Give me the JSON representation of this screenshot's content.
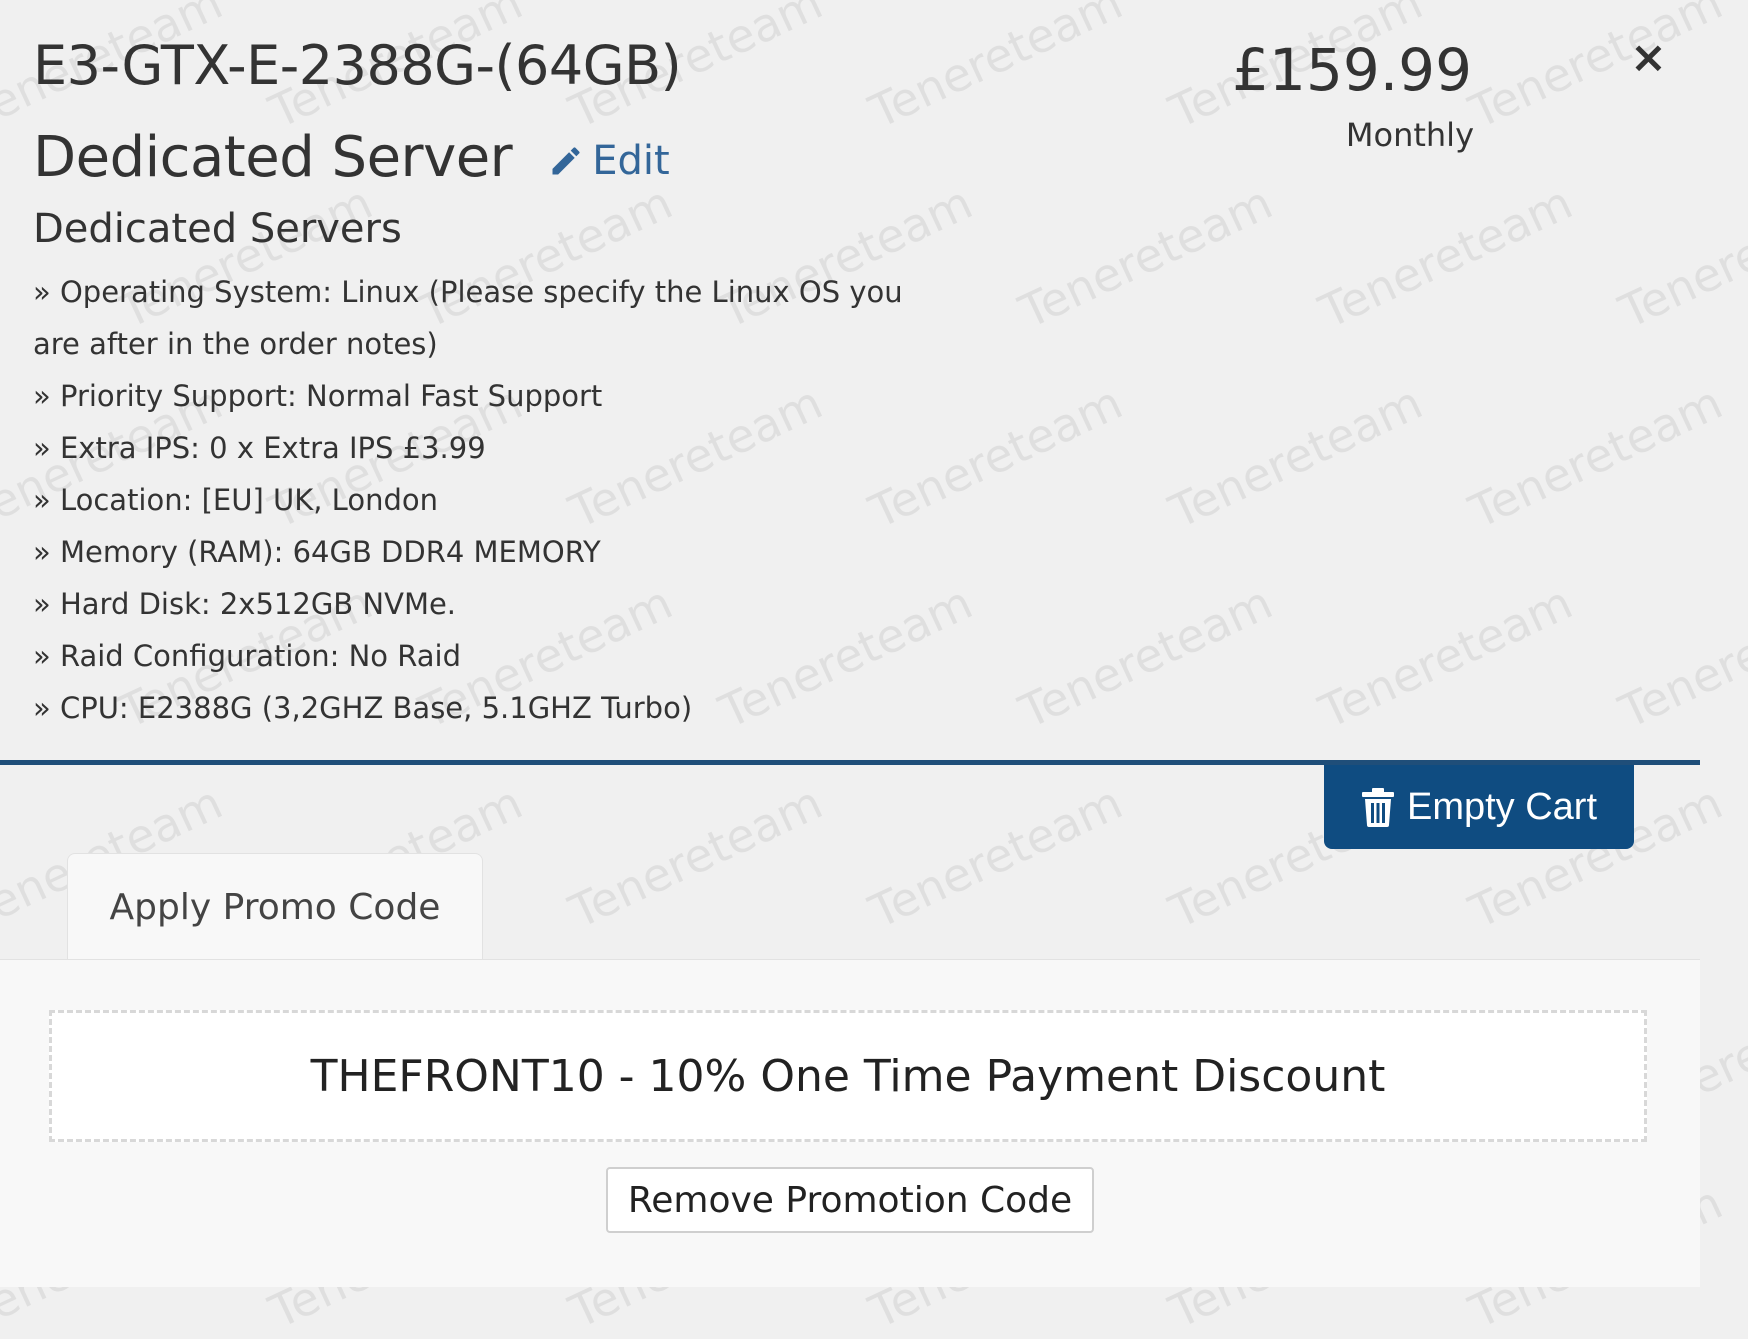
{
  "item": {
    "product_name": "E3-GTX-E-2388G-(64GB)",
    "product_type": "Dedicated Server",
    "edit_label": "Edit",
    "product_group": "Dedicated Servers",
    "price": "£159.99",
    "billing_cycle": "Monthly",
    "remove_symbol": "×",
    "options": [
      "» Operating System: Linux (Please specify the Linux OS you are after in the order notes)",
      "» Priority Support: Normal Fast Support",
      "» Extra IPS: 0 x Extra IPS £3.99",
      "» Location: [EU] UK, London",
      "» Memory (RAM): 64GB DDR4 MEMORY",
      "» Hard Disk: 2x512GB NVMe.",
      "» Raid Configuration: No Raid",
      "» CPU: E2388G (3,2GHZ Base, 5.1GHZ Turbo)"
    ]
  },
  "cart": {
    "empty_cart_label": "Empty Cart"
  },
  "promo": {
    "tab_label": "Apply Promo Code",
    "applied_code_text": "THEFRONT10 - 10% One Time Payment Discount",
    "remove_button_label": "Remove Promotion Code"
  },
  "watermark": {
    "text": "Tenereteam"
  },
  "colors": {
    "accent": "#0f4c81",
    "divider": "#1f4e79",
    "link": "#336699",
    "background": "#f0f0f0"
  },
  "icons": {
    "edit": "pencil-icon",
    "remove": "close-icon",
    "empty_cart": "trash-icon"
  }
}
